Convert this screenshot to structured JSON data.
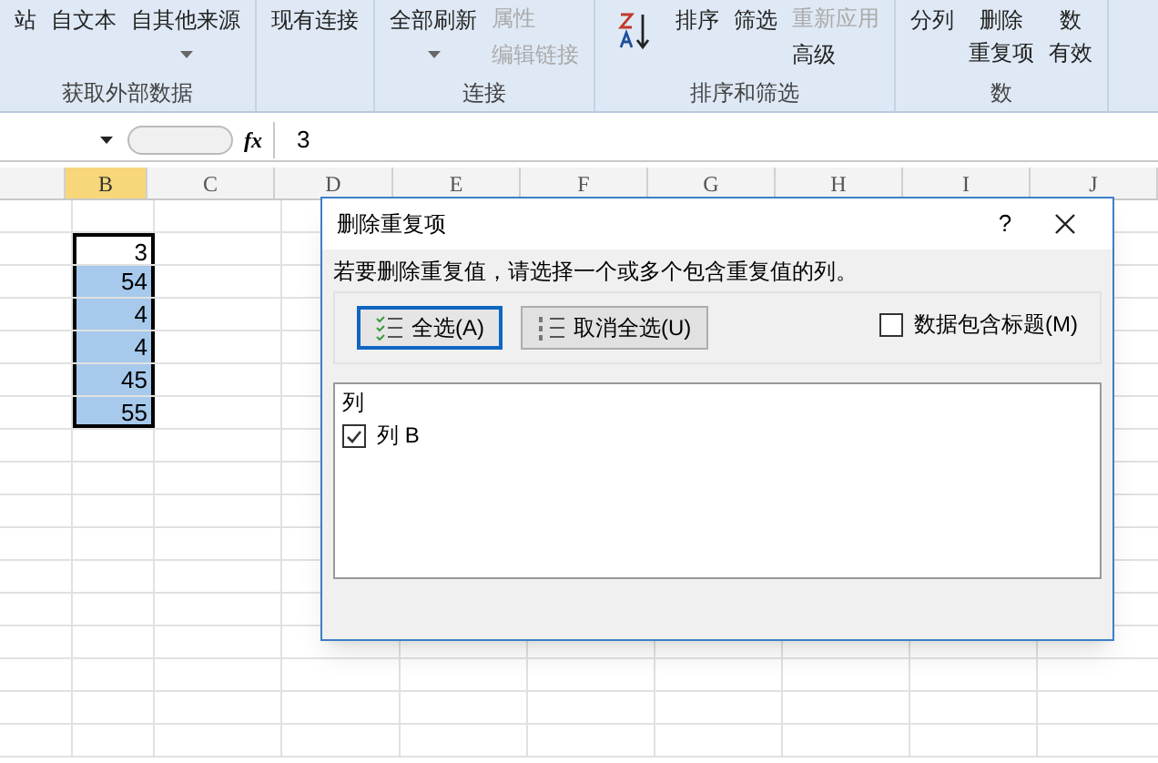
{
  "ribbon": {
    "groups": [
      {
        "label": "获取外部数据",
        "commands": [
          {
            "kind": "big",
            "label": "站",
            "disabled": false
          },
          {
            "kind": "big",
            "label": "自文本",
            "disabled": false
          },
          {
            "kind": "big",
            "label": "自其他来源",
            "dropdown": true,
            "disabled": false
          }
        ]
      },
      {
        "commands": [
          {
            "kind": "big",
            "label": "现有连接",
            "disabled": false
          }
        ]
      },
      {
        "label": "连接",
        "commands": [
          {
            "kind": "big",
            "label": "全部刷新",
            "dropdown": true,
            "disabled": false
          },
          {
            "kind": "stack",
            "items": [
              {
                "label": "属性",
                "disabled": true
              },
              {
                "label": "编辑链接",
                "disabled": true
              }
            ]
          }
        ]
      },
      {
        "label": "排序和筛选",
        "commands": [
          {
            "kind": "sort"
          },
          {
            "kind": "big",
            "label": "排序",
            "disabled": false
          },
          {
            "kind": "big",
            "label": "筛选",
            "disabled": false
          },
          {
            "kind": "stack",
            "items": [
              {
                "label": "重新应用",
                "disabled": true
              },
              {
                "label": "高级",
                "disabled": false
              }
            ]
          }
        ]
      },
      {
        "label": "数",
        "commands": [
          {
            "kind": "big",
            "label": "分列",
            "disabled": false
          },
          {
            "kind": "big",
            "lines": [
              "删除",
              "重复项"
            ],
            "disabled": false
          },
          {
            "kind": "big",
            "lines": [
              "数",
              "有效"
            ],
            "disabled": false
          }
        ]
      }
    ]
  },
  "formula_bar": {
    "fx": "fx",
    "value": "3"
  },
  "sheet": {
    "columns": [
      {
        "label": "B",
        "selected": true
      },
      {
        "label": "C",
        "selected": false
      },
      {
        "label": "D",
        "selected": false
      },
      {
        "label": "E",
        "selected": false
      },
      {
        "label": "F",
        "selected": false
      },
      {
        "label": "G",
        "selected": false
      },
      {
        "label": "H",
        "selected": false
      },
      {
        "label": "I",
        "selected": false
      },
      {
        "label": "J",
        "selected": false
      }
    ],
    "cells": [
      {
        "value": "3",
        "selected": false
      },
      {
        "value": "54",
        "selected": true
      },
      {
        "value": "4",
        "selected": true
      },
      {
        "value": "4",
        "selected": true
      },
      {
        "value": "45",
        "selected": true
      },
      {
        "value": "55",
        "selected": true
      }
    ]
  },
  "dialog": {
    "title": "删除重复项",
    "help": "?",
    "instruction": "若要删除重复值，请选择一个或多个包含重复值的列。",
    "buttons": [
      {
        "label": "全选(A)",
        "kind": "select",
        "focused": true
      },
      {
        "label": "取消全选(U)",
        "kind": "unselect",
        "focused": false
      }
    ],
    "header_option": {
      "label": "数据包含标题(M)",
      "checked": false
    },
    "list": {
      "heading": "列",
      "items": [
        {
          "label": "列 B",
          "checked": true
        }
      ]
    }
  }
}
